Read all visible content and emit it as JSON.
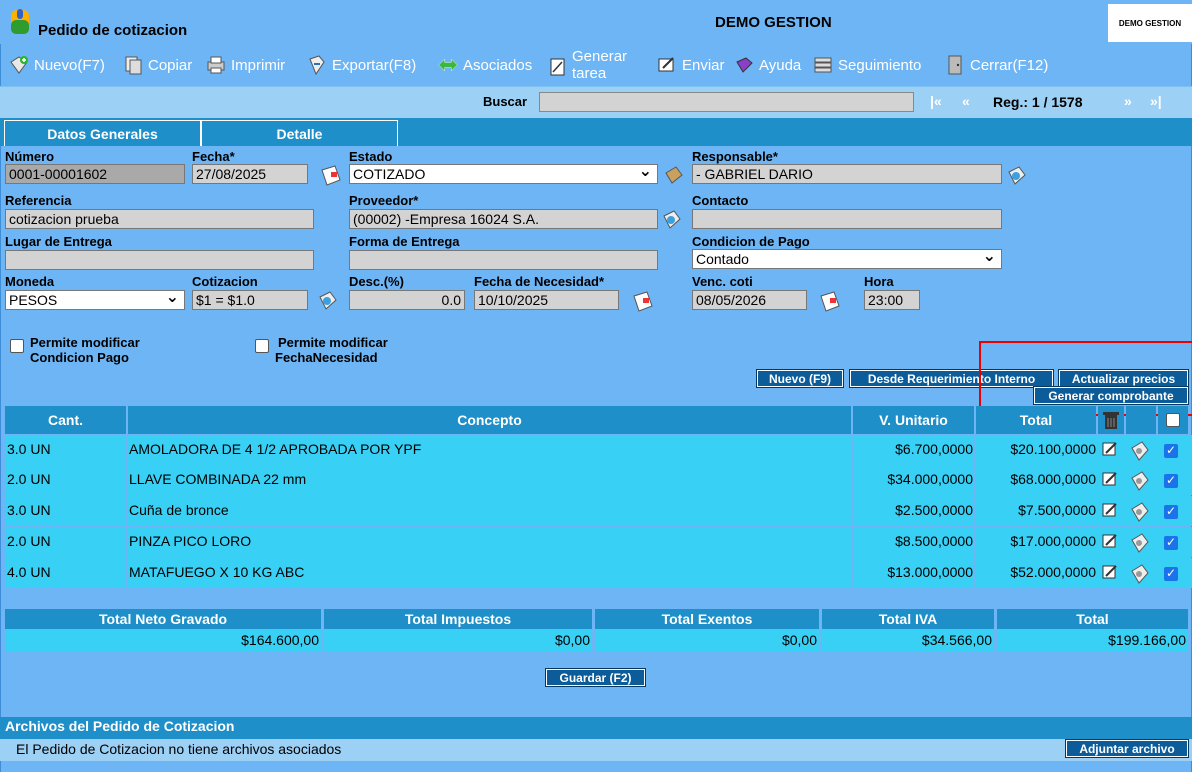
{
  "window": {
    "title": "Pedido de cotizacion",
    "company": "DEMO GESTION",
    "logo_text": "DEMO GESTION"
  },
  "toolbar": {
    "nuevo": "Nuevo(F7)",
    "copiar": "Copiar",
    "imprimir": "Imprimir",
    "exportar": "Exportar(F8)",
    "asociados": "Asociados",
    "generar_tarea_1": "Generar",
    "generar_tarea_2": "tarea",
    "enviar": "Enviar",
    "ayuda": "Ayuda",
    "seguimiento": "Seguimiento",
    "cerrar": "Cerrar(F12)"
  },
  "search": {
    "label": "Buscar",
    "value": "",
    "first": "|«",
    "prev": "«",
    "reg_label": "Reg.: 1 / 1578",
    "next": "»",
    "last": "»|"
  },
  "tabs": [
    {
      "label": "Datos Generales"
    },
    {
      "label": "Detalle"
    }
  ],
  "form": {
    "numero": {
      "label": "Número",
      "value": "0001-00001602"
    },
    "fecha": {
      "label": "Fecha*",
      "value": "27/08/2025"
    },
    "estado": {
      "label": "Estado",
      "value": "COTIZADO"
    },
    "responsable": {
      "label": "Responsable*",
      "value": "- GABRIEL DARIO"
    },
    "referencia": {
      "label": "Referencia",
      "value": "cotizacion prueba"
    },
    "proveedor": {
      "label": "Proveedor*",
      "value": "(00002) -Empresa 16024 S.A."
    },
    "contacto": {
      "label": "Contacto",
      "value": ""
    },
    "lugar_entrega": {
      "label": "Lugar de Entrega",
      "value": ""
    },
    "forma_entrega": {
      "label": "Forma de Entrega",
      "value": ""
    },
    "condicion_pago": {
      "label": "Condicion de Pago",
      "value": "Contado"
    },
    "moneda": {
      "label": "Moneda",
      "value": "PESOS"
    },
    "cotizacion": {
      "label": "Cotizacion",
      "value": "$1 = $1.0"
    },
    "desc": {
      "label": "Desc.(%)",
      "value": "0.0"
    },
    "fecha_necesidad": {
      "label": "Fecha de Necesidad*",
      "value": "10/10/2025"
    },
    "venc_coti": {
      "label": "Venc. coti",
      "value": "08/05/2026"
    },
    "hora": {
      "label": "Hora",
      "value": "23:00"
    },
    "chk_condicion_1": "Permite modificar",
    "chk_condicion_2": "Condicion Pago",
    "chk_fecha_1": "Permite modificar",
    "chk_fecha_2": "FechaNecesidad"
  },
  "actions": {
    "nuevo": "Nuevo (F9)",
    "desde_req": "Desde Requerimiento Interno",
    "actualizar": "Actualizar precios",
    "generar": "Generar comprobante"
  },
  "grid": {
    "headers": {
      "cant": "Cant.",
      "concepto": "Concepto",
      "unitario": "V. Unitario",
      "total": "Total"
    },
    "rows": [
      {
        "cant": "3.0 UN",
        "concepto": "AMOLADORA DE 4 1/2 APROBADA POR YPF",
        "unitario": "$6.700,0000",
        "total": "$20.100,0000"
      },
      {
        "cant": "2.0 UN",
        "concepto": "LLAVE COMBINADA 22 mm",
        "unitario": "$34.000,0000",
        "total": "$68.000,0000"
      },
      {
        "cant": "3.0 UN",
        "concepto": "Cuña de bronce",
        "unitario": "$2.500,0000",
        "total": "$7.500,0000"
      },
      {
        "cant": "2.0 UN",
        "concepto": "PINZA PICO LORO",
        "unitario": "$8.500,0000",
        "total": "$17.000,0000"
      },
      {
        "cant": "4.0 UN",
        "concepto": "MATAFUEGO X 10 KG ABC",
        "unitario": "$13.000,0000",
        "total": "$52.000,0000"
      }
    ]
  },
  "totals": {
    "neto": {
      "label": "Total Neto Gravado",
      "value": "$164.600,00"
    },
    "impuestos": {
      "label": "Total Impuestos",
      "value": "$0,00"
    },
    "exentos": {
      "label": "Total Exentos",
      "value": "$0,00"
    },
    "iva": {
      "label": "Total IVA",
      "value": "$34.566,00"
    },
    "total": {
      "label": "Total",
      "value": "$199.166,00"
    }
  },
  "guardar": "Guardar (F2)",
  "files": {
    "title": "Archivos del Pedido de Cotizacion",
    "empty": "El Pedido de Cotizacion no tiene archivos asociados",
    "adjuntar": "Adjuntar archivo"
  }
}
